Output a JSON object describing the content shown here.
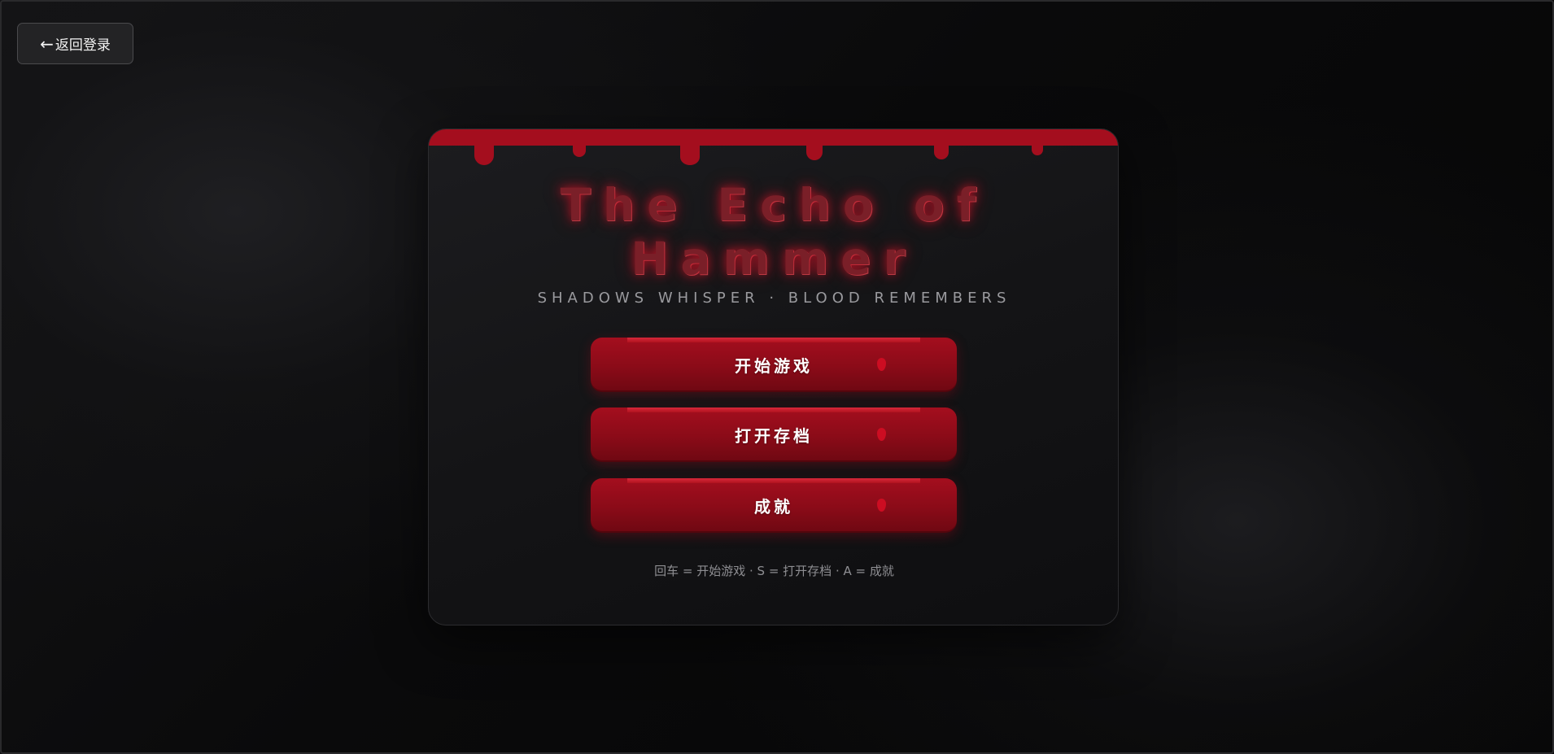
{
  "back_button": {
    "arrow": "←",
    "label": "返回登录"
  },
  "game": {
    "title": "The Echo of\nHammer",
    "subtitle": "SHADOWS WHISPER · BLOOD REMEMBERS"
  },
  "menu": {
    "buttons": [
      {
        "label": "开始游戏"
      },
      {
        "label": "打开存档"
      },
      {
        "label": "成就"
      }
    ]
  },
  "hint": "回车 = 开始游戏 · S = 打开存档 · A = 成就",
  "colors": {
    "blood": "#a40e1e",
    "blood_dark": "#6e0812",
    "background": "#0a0a0b",
    "panel": "#161618"
  }
}
